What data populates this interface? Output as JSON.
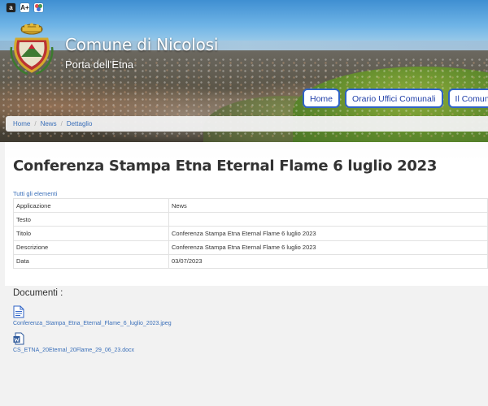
{
  "accessibility": {
    "contrast_label": "a",
    "font_size_label": "A+",
    "color_label": "colori"
  },
  "header": {
    "title": "Comune di Nicolosi",
    "subtitle": "Porta dell'Etna",
    "logo_icon": "coat-of-arms-icon"
  },
  "nav": {
    "items": [
      {
        "label": "Home"
      },
      {
        "label": "Orario Uffici Comunali"
      },
      {
        "label": "Il Comune"
      }
    ]
  },
  "breadcrumb": {
    "items": [
      {
        "label": "Home"
      },
      {
        "label": "News"
      },
      {
        "label": "Dettaglio"
      }
    ],
    "separator": "/"
  },
  "main": {
    "title": "Conferenza Stampa Etna Eternal Flame 6 luglio 2023",
    "all_items_link": "Tutti gli elementi",
    "rows": [
      {
        "key": "Applicazione",
        "value": "News"
      },
      {
        "key": "Testo",
        "value": ""
      },
      {
        "key": "Titolo",
        "value": "Conferenza Stampa Etna Eternal Flame 6 luglio 2023"
      },
      {
        "key": "Descrizione",
        "value": "Conferenza Stampa Etna Eternal Flame 6 luglio 2023"
      },
      {
        "key": "Data",
        "value": "03/07/2023"
      }
    ]
  },
  "documents": {
    "title": "Documenti :",
    "files": [
      {
        "name": "Conferenza_Stampa_Etna_Eternal_Flame_6_luglio_2023.jpeg",
        "icon": "file-image-icon"
      },
      {
        "name": "CS_ETNA_20Eternal_20Flame_29_06_23.docx",
        "icon": "word-doc-icon"
      }
    ]
  },
  "colors": {
    "nav_border": "#2f63c6",
    "nav_text": "#1f3ea8",
    "link": "#3a6fb9",
    "page_bg": "#f2f2f2"
  }
}
